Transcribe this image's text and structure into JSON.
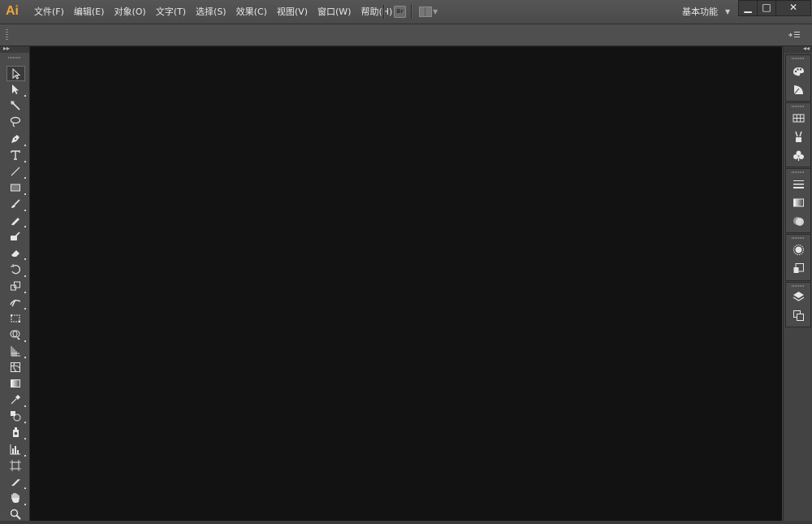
{
  "app": {
    "logo": "Ai"
  },
  "menubar": {
    "items": [
      "文件(F)",
      "编辑(E)",
      "对象(O)",
      "文字(T)",
      "选择(S)",
      "效果(C)",
      "视图(V)",
      "窗口(W)",
      "帮助(H)"
    ],
    "bridge_label": "Br",
    "workspace_label": "基本功能"
  },
  "window_controls": {
    "minimize": "▁",
    "maximize": "□",
    "close": "✕"
  },
  "toolbar": {
    "tools": [
      "selection-tool",
      "direct-selection-tool",
      "magic-wand-tool",
      "lasso-tool",
      "pen-tool",
      "type-tool",
      "line-segment-tool",
      "rectangle-tool",
      "paintbrush-tool",
      "pencil-tool",
      "blob-brush-tool",
      "eraser-tool",
      "rotate-tool",
      "scale-tool",
      "width-tool",
      "free-transform-tool",
      "shape-builder-tool",
      "perspective-grid-tool",
      "mesh-tool",
      "gradient-tool",
      "eyedropper-tool",
      "blend-tool",
      "symbol-sprayer-tool",
      "column-graph-tool",
      "artboard-tool",
      "slice-tool",
      "hand-tool",
      "zoom-tool"
    ],
    "active_tool": "selection-tool"
  },
  "dock": {
    "groups": [
      [
        "color-panel-icon",
        "color-guide-panel-icon"
      ],
      [
        "swatches-panel-icon",
        "brushes-panel-icon",
        "symbols-panel-icon"
      ],
      [
        "stroke-panel-icon",
        "gradient-panel-icon",
        "transparency-panel-icon"
      ],
      [
        "appearance-panel-icon",
        "graphic-styles-panel-icon"
      ],
      [
        "layers-panel-icon",
        "artboards-panel-icon"
      ]
    ]
  },
  "colors": {
    "accent_logo": "#f0a53a",
    "canvas": "#121212",
    "chrome": "#4b4b4b"
  }
}
